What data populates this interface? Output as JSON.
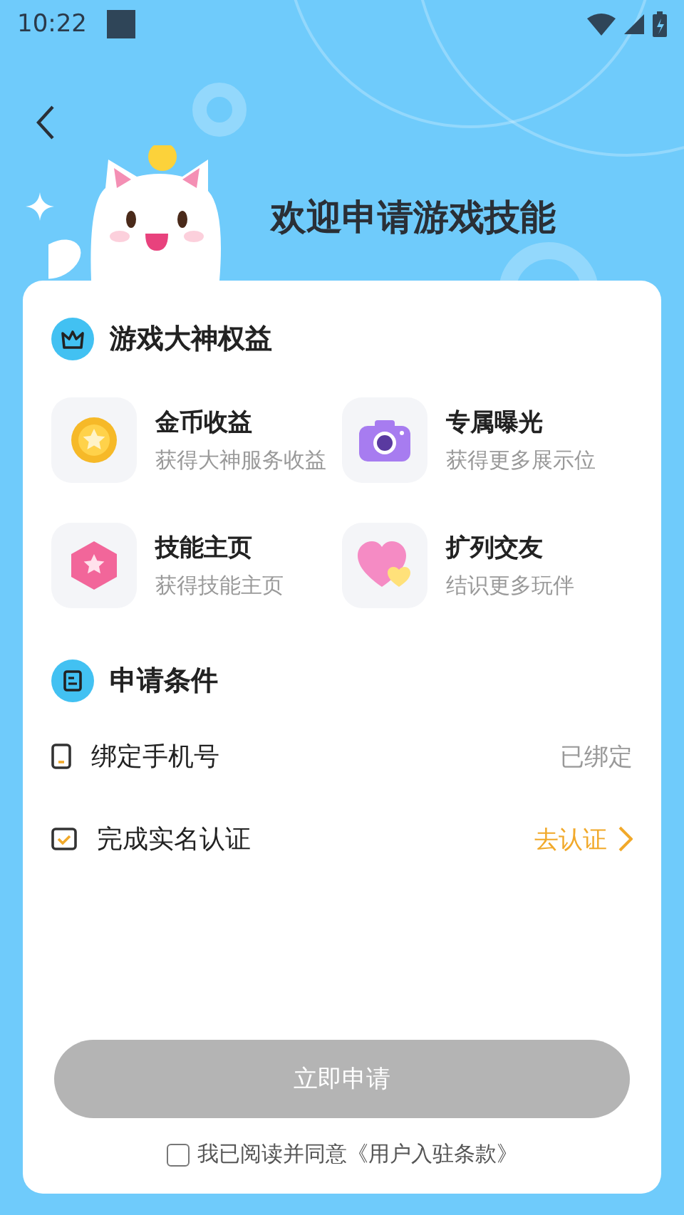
{
  "status_bar": {
    "time": "10:22"
  },
  "header": {
    "title": "欢迎申请游戏技能"
  },
  "benefits": {
    "title": "游戏大神权益",
    "items": [
      {
        "kind": "coin",
        "name": "金币收益",
        "desc": "获得大神服务收益"
      },
      {
        "kind": "camera",
        "name": "专属曝光",
        "desc": "获得更多展示位"
      },
      {
        "kind": "badge",
        "name": "技能主页",
        "desc": "获得技能主页"
      },
      {
        "kind": "heart",
        "name": "扩列交友",
        "desc": "结识更多玩伴"
      }
    ]
  },
  "conditions": {
    "title": "申请条件",
    "items": [
      {
        "kind": "phone",
        "label": "绑定手机号",
        "status": "已绑定",
        "done": true
      },
      {
        "kind": "id",
        "label": "完成实名认证",
        "status": "去认证",
        "done": false
      }
    ]
  },
  "submit": {
    "label": "立即申请",
    "disabled": true
  },
  "agreement": {
    "text": "我已阅读并同意《用户入驻条款》",
    "checked": false
  }
}
